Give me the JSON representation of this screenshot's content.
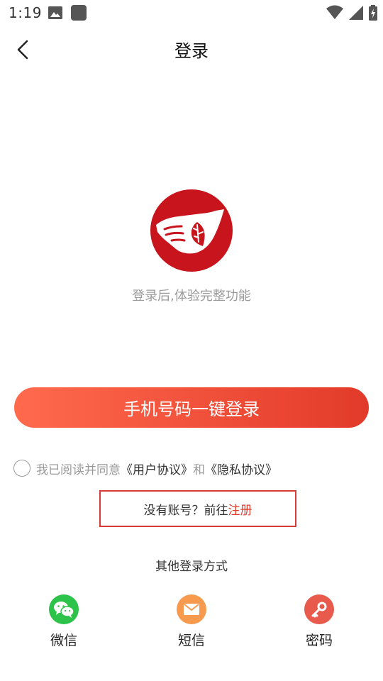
{
  "status_bar": {
    "time": "1:19"
  },
  "header": {
    "title": "登录"
  },
  "brand": {
    "slogan": "登录后,体验完整功能"
  },
  "primary_button": {
    "label": "手机号码一键登录"
  },
  "agreement": {
    "prefix": "我已阅读并同意",
    "user_agreement": "《用户协议》",
    "and": "和",
    "privacy_policy": "《隐私协议》"
  },
  "register": {
    "prompt": "没有账号？前往",
    "link": "注册"
  },
  "other_login": {
    "title": "其他登录方式",
    "options": [
      {
        "label": "微信",
        "icon": "wechat-icon",
        "color": "#2dc24a"
      },
      {
        "label": "短信",
        "icon": "mail-icon",
        "color": "#f79a4e"
      },
      {
        "label": "密码",
        "icon": "key-icon",
        "color": "#e85a4c"
      }
    ]
  },
  "colors": {
    "accent": "#e23a2a",
    "brand_red": "#c8141c",
    "highlight_border": "#d63a3a"
  }
}
